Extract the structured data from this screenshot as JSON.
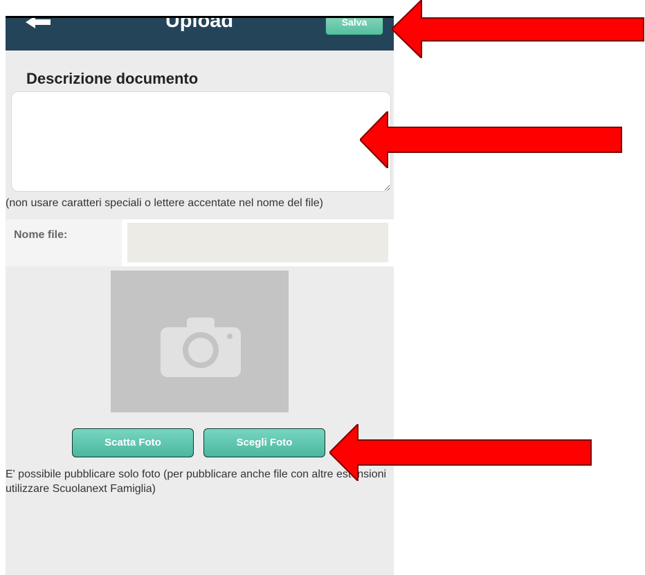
{
  "header": {
    "title": "Upload",
    "back_icon": "arrow-left-icon",
    "save_label": "Salva"
  },
  "form": {
    "section_title": "Descrizione documento",
    "description_value": "",
    "hint": "(non usare caratteri speciali o lettere accentate nel nome del file)",
    "file_name_label": "Nome file:",
    "file_name_value": ""
  },
  "photo": {
    "placeholder_icon": "camera-icon",
    "take_photo_label": "Scatta Foto",
    "choose_photo_label": "Scegli Foto"
  },
  "note": "E' possibile pubblicare solo foto (per pubblicare anche file con altre estensioni utilizzare Scuolanext Famiglia)",
  "annotations": {
    "arrow_color": "#ff0000"
  },
  "colors": {
    "header_bg": "#244459",
    "button_green": "#53bfa0",
    "page_bg": "#ececec"
  }
}
